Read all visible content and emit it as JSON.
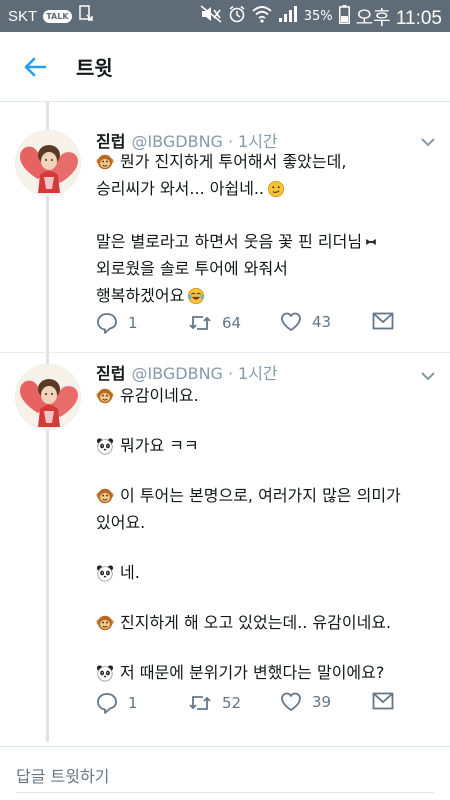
{
  "status_bar": {
    "carrier": "SKT",
    "talk_badge": "TALK",
    "battery_percent": "35%",
    "time": "오후 11:05"
  },
  "header": {
    "title": "트윗",
    "back_icon": "arrow-left-icon"
  },
  "colors": {
    "accent": "#1da1f2",
    "muted": "#8899a6",
    "status_bar": "#5f6b77"
  },
  "tweets": [
    {
      "name": "짇럽",
      "handle": "@IBGDBNG",
      "separator": "·",
      "time": "1시간",
      "lines": [
        "뭔가 진지하게 투어해서 좋았는데,",
        "승리씨가 와서... 아쉽네..",
        "말은 별로라고 하면서 웃음 꽃 핀 리더님",
        "외로웠을 솔로 투어에 와줘서",
        "행복하겠어요"
      ],
      "reply_count": "1",
      "retweet_count": "64",
      "like_count": "43"
    },
    {
      "name": "짇럽",
      "handle": "@IBGDBNG",
      "separator": "·",
      "time": "1시간",
      "lines": [
        "유감이네요.",
        "뭐가요 ㅋㅋ",
        "이 투어는 본명으로, 여러가지 많은 의미가",
        "있어요.",
        "네.",
        "진지하게 해 오고 있었는데.. 유감이네요.",
        "저 때문에 분위기가 변했다는 말이에요?"
      ],
      "reply_count": "1",
      "retweet_count": "52",
      "like_count": "39"
    }
  ],
  "reply": {
    "placeholder": "답글 트윗하기"
  }
}
